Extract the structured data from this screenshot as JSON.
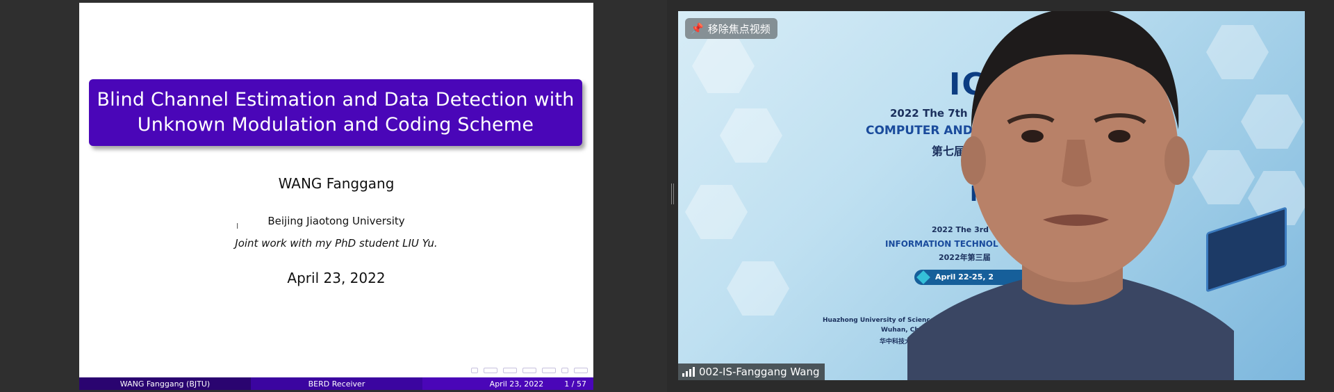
{
  "slide": {
    "title_line1": "Blind Channel Estimation and Data Detection with",
    "title_line2": "Unknown Modulation and Coding Scheme",
    "author": "WANG Fanggang",
    "institution": "Beijing Jiaotong University",
    "joint_work": "Joint work with my PhD student LIU Yu.",
    "date": "April 23, 2022",
    "title_color": "#4a06b8",
    "footer": {
      "left": "WANG Fanggang  (BJTU)",
      "middle": "BERD Receiver",
      "date": "April 23, 2022",
      "page": "1 / 57"
    }
  },
  "video": {
    "focus_button_label": "移除焦点视频",
    "participant_name": "002-IS-Fanggang Wang",
    "banner": {
      "logo": "ICCCS",
      "line1": "2022 The 7th Internati",
      "line2": "COMPUTER AND COMM",
      "line3": "第七届计算机与",
      "logo2": "ITIC",
      "line4": "2022 The 3rd Int",
      "line5": "INFORMATION TECHNOL",
      "line6": "2022年第三届",
      "date": "April 22-25, 2",
      "line7": "Huazhong University of Science and Technology (HUST",
      "line8": "Wuhan, China (Virtual)",
      "line9": "华中科技大学 | 中国武汉"
    }
  }
}
